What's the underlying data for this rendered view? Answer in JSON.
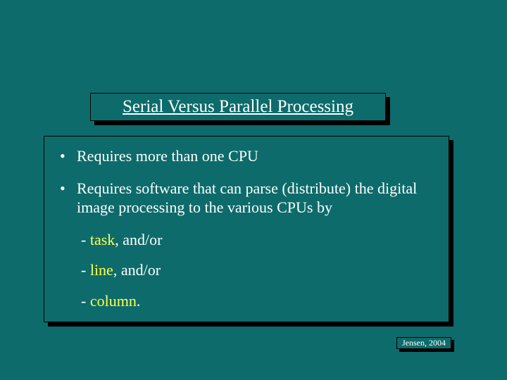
{
  "title": "Serial Versus Parallel Processing",
  "bullets": [
    "Requires more than one CPU",
    "Requires software that can parse (distribute) the digital image processing to the various CPUs by"
  ],
  "subitems": [
    {
      "label": "task",
      "suffix": ", and/or"
    },
    {
      "label": "line",
      "suffix": ", and/or"
    },
    {
      "label": "column",
      "suffix": "."
    }
  ],
  "attribution": "Jensen, 2004"
}
